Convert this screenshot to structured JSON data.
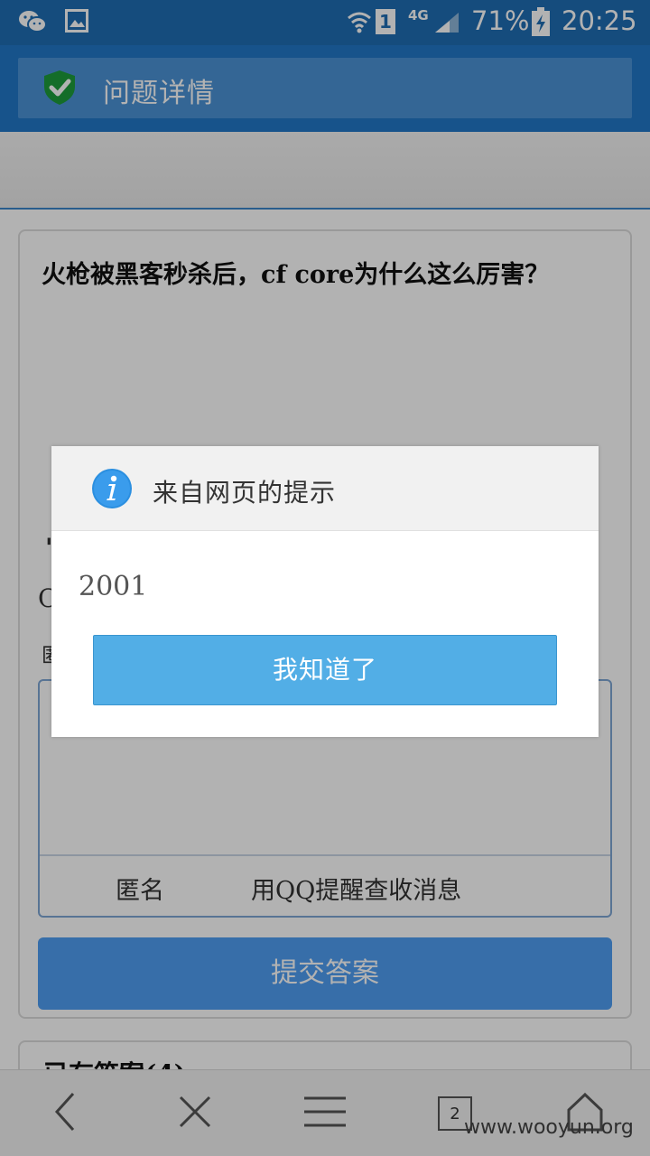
{
  "status_bar": {
    "sim_slot": "1",
    "network": "4G",
    "battery": "71%",
    "time": "20:25"
  },
  "header": {
    "title": "问题详情"
  },
  "question": {
    "title": "火枪被黑客秒杀后，cf core为什么这么厉害？"
  },
  "answer_form": {
    "options": [
      "匿名",
      "用QQ提醒查收消息"
    ],
    "submit_label": "提交答案"
  },
  "answers_section": {
    "heading": "已有答案(4)"
  },
  "bottom_nav": {
    "tab_count": "2"
  },
  "watermark": "www.wooyun.org",
  "dialog": {
    "title": "来自网页的提示",
    "message": "2001",
    "button_label": "我知道了"
  },
  "colors": {
    "status_bar": "#1f6db3",
    "header": "#2278c8",
    "submit_button": "#4f9ef2",
    "dialog_button": "#52aee6"
  }
}
